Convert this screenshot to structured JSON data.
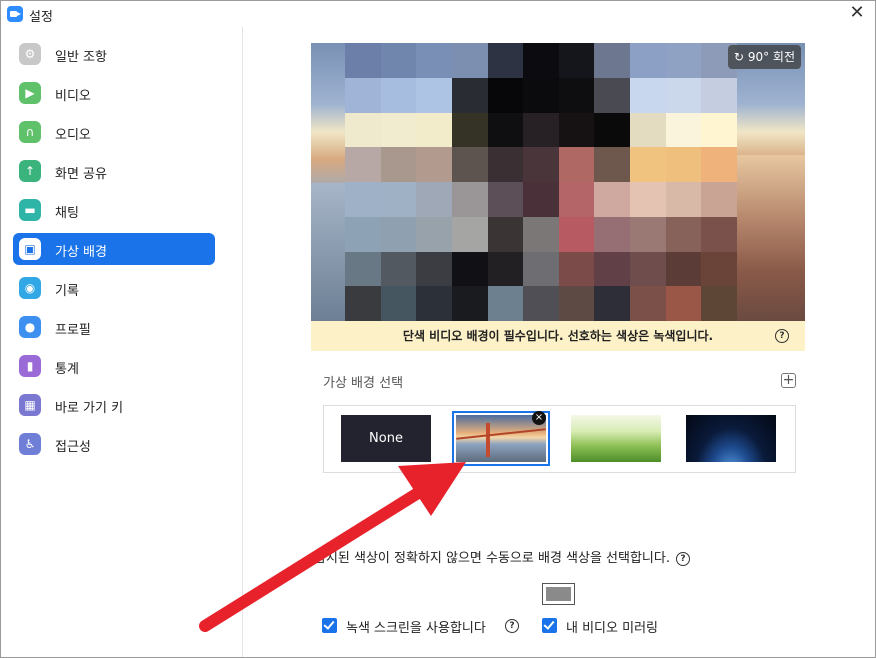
{
  "window": {
    "title": "설정",
    "close_label": "✕"
  },
  "sidebar": {
    "items": [
      {
        "label": "일반 조항",
        "color": "#c8c8c8",
        "glyph": "⚙",
        "active": false
      },
      {
        "label": "비디오",
        "color": "#5fc26b",
        "glyph": "▶",
        "active": false
      },
      {
        "label": "오디오",
        "color": "#5fc26b",
        "glyph": "∩",
        "active": false
      },
      {
        "label": "화면 공유",
        "color": "#3bb37d",
        "glyph": "↑",
        "active": false
      },
      {
        "label": "채팅",
        "color": "#2fb5a8",
        "glyph": "▬",
        "active": false
      },
      {
        "label": "가상 배경",
        "color": "#1a73e8",
        "glyph": "▣",
        "active": true
      },
      {
        "label": "기록",
        "color": "#32a7e6",
        "glyph": "◉",
        "active": false
      },
      {
        "label": "프로필",
        "color": "#3d8ff0",
        "glyph": "●",
        "active": false
      },
      {
        "label": "통계",
        "color": "#9a6ad6",
        "glyph": "▮",
        "active": false
      },
      {
        "label": "바로 가기 키",
        "color": "#7a78d0",
        "glyph": "▦",
        "active": false
      },
      {
        "label": "접근성",
        "color": "#6f7fd8",
        "glyph": "♿",
        "active": false
      }
    ]
  },
  "preview": {
    "rotate_label": "90° 회전",
    "warning": "단색 비디오 배경이 필수입니다. 선호하는 색상은 녹색입니다.",
    "pixel_colors": [
      [
        "#6b7fa8",
        "#7086ad",
        "#7a8fb6",
        "#7d8fb0",
        "#2d3342",
        "#0c0c10",
        "#15161b",
        "#6d7890",
        "#8ba0c4",
        "#90a2c4",
        "#8d9bb8"
      ],
      [
        "#9fb4d7",
        "#a6bde0",
        "#aec4e4",
        "#2a2c33",
        "#070709",
        "#0b0a0c",
        "#0e0d10",
        "#4a4b52",
        "#c9d7ee",
        "#cbd8ec",
        "#c5cde0"
      ],
      [
        "#efe9cd",
        "#f1ecd0",
        "#f2eccb",
        "#353226",
        "#0f0e10",
        "#272024",
        "#161214",
        "#0a0a0b",
        "#e3dcc0",
        "#fbf4dc",
        "#fff6d1"
      ],
      [
        "#b7a8a6",
        "#a8988e",
        "#b39a8e",
        "#5d544f",
        "#3a3034",
        "#4a363a",
        "#b06864",
        "#6e584e",
        "#f0c37e",
        "#efbf7e",
        "#eeb27a"
      ],
      [
        "#9fb1c7",
        "#9fb1c5",
        "#9ea8b6",
        "#9a9698",
        "#5d4f58",
        "#4a3038",
        "#b46567",
        "#cfa9a0",
        "#e5c3b2",
        "#d8b9a8",
        "#c9a494"
      ],
      [
        "#8ea2b6",
        "#8fa0b0",
        "#98a2ab",
        "#a5a5a3",
        "#3a3434",
        "#7c7777",
        "#b75a62",
        "#956f73",
        "#9a7873",
        "#86625b",
        "#7a524b"
      ],
      [
        "#697885",
        "#535960",
        "#3b3d43",
        "#111115",
        "#222023",
        "#6e6e72",
        "#7b4b4a",
        "#624048",
        "#6e4d4c",
        "#5c3c37",
        "#6a4439"
      ],
      [
        "#3a3b3e",
        "#455661",
        "#2c3038",
        "#1a1b1f",
        "#6c808f",
        "#4f4f55",
        "#5e4a44",
        "#2e2e38",
        "#7a5048",
        "#9a5646",
        "#5e4636"
      ]
    ]
  },
  "backgrounds": {
    "section_title": "가상 배경 선택",
    "add_label": "+",
    "remove_label": "×",
    "thumbnails": [
      {
        "label": "None",
        "kind": "none"
      },
      {
        "label": "",
        "kind": "bridge"
      },
      {
        "label": "",
        "kind": "grass"
      },
      {
        "label": "",
        "kind": "earth"
      }
    ]
  },
  "manual": {
    "text": "감지된 색상이 정확하지 않으면 수동으로 배경 색상을 선택합니다.",
    "help": "?",
    "swatch_color": "#8a8a8a"
  },
  "options": {
    "green_screen_label": "녹색 스크린을 사용합니다",
    "green_screen_checked": true,
    "mirror_label": "내 비디오 미러링",
    "mirror_checked": true,
    "help": "?"
  },
  "annotation": {
    "arrow_color": "#e8222a"
  }
}
